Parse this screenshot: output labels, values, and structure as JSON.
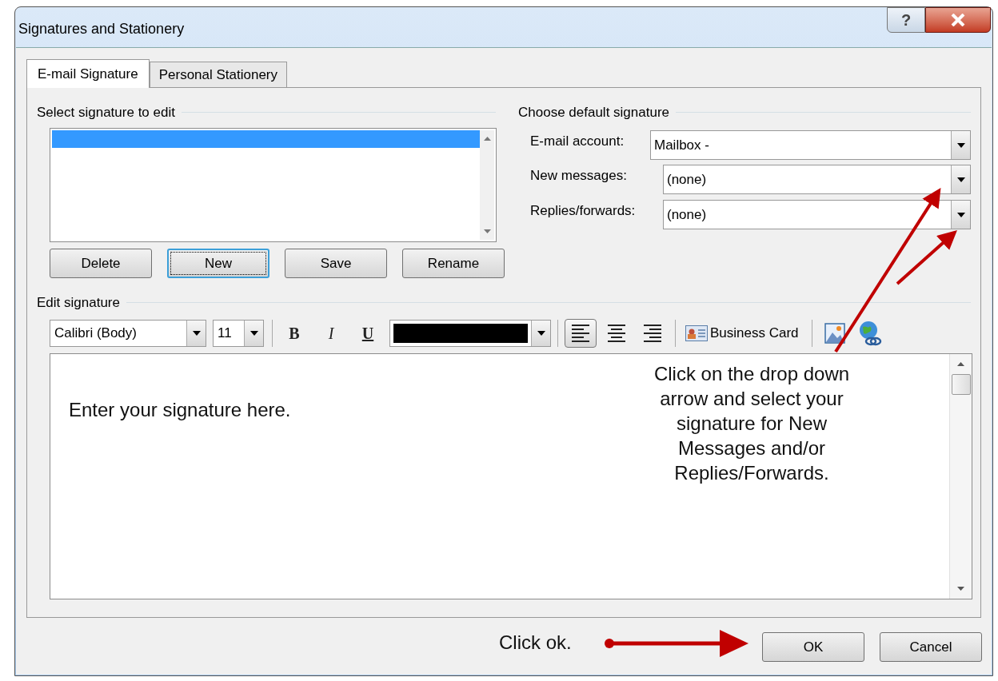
{
  "window": {
    "title": "Signatures and Stationery",
    "help": "?"
  },
  "tabs": [
    {
      "label": "E-mail Signature",
      "selected": true
    },
    {
      "label": "Personal Stationery",
      "selected": false
    }
  ],
  "select_signature": {
    "heading": "Select signature to edit",
    "items": [
      {
        "selected": true
      }
    ],
    "buttons": [
      {
        "label": "Delete",
        "focused": false
      },
      {
        "label": "New",
        "focused": true
      },
      {
        "label": "Save",
        "focused": false
      },
      {
        "label": "Rename",
        "focused": false
      }
    ]
  },
  "default_signature": {
    "heading": "Choose default signature",
    "fields": [
      {
        "label": "E-mail account:",
        "value": "Mailbox -"
      },
      {
        "label": "New messages:",
        "value": "(none)"
      },
      {
        "label": "Replies/forwards:",
        "value": "(none)"
      }
    ]
  },
  "edit_signature": {
    "heading": "Edit signature",
    "font": "Calibri (Body)",
    "size": "11",
    "styles": [
      {
        "kind": "bold",
        "label": "B"
      },
      {
        "kind": "italic",
        "label": "I"
      },
      {
        "kind": "underline",
        "label": "U"
      }
    ],
    "alignments": [
      {
        "kind": "left",
        "selected": true
      },
      {
        "kind": "center",
        "selected": false
      },
      {
        "kind": "right",
        "selected": false
      }
    ],
    "business_card": "Business Card",
    "body_text": "Enter your signature here."
  },
  "buttons": [
    "OK",
    "Cancel"
  ],
  "annotations": [
    {
      "kind": "dropdowns",
      "text": "Click on the drop down arrow and select your signature for New Messages and/or Replies/Forwards."
    },
    {
      "kind": "ok",
      "text": "Click ok."
    }
  ]
}
